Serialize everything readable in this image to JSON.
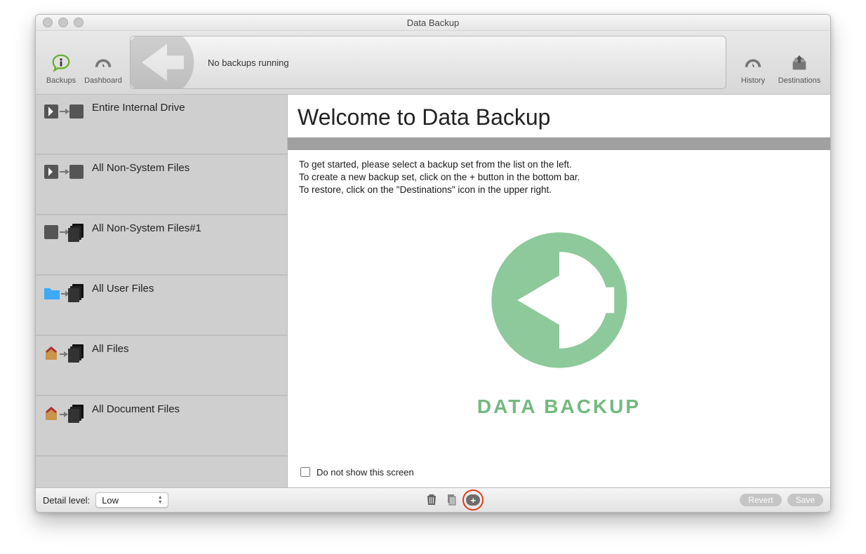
{
  "window": {
    "title": "Data Backup"
  },
  "toolbar": {
    "backups_label": "Backups",
    "dashboard_label": "Dashboard",
    "history_label": "History",
    "destinations_label": "Destinations",
    "status_text": "No backups running"
  },
  "sidebar": {
    "items": [
      {
        "label": "Entire Internal Drive",
        "icon": "drive-to-drive"
      },
      {
        "label": "All Non-System Files",
        "icon": "drive-to-drive"
      },
      {
        "label": "All Non-System Files#1",
        "icon": "drive-to-stack"
      },
      {
        "label": "All User Files",
        "icon": "folder-to-stack"
      },
      {
        "label": "All Files",
        "icon": "home-to-stack"
      },
      {
        "label": "All Document Files",
        "icon": "home-to-stack"
      }
    ]
  },
  "content": {
    "heading": "Welcome to Data Backup",
    "intro_line1": "To get started, please select a backup set from the list on the left.",
    "intro_line2": "To create a new backup set, click on the + button in the bottom bar.",
    "intro_line3": "To restore, click on the \"Destinations\" icon in the upper right.",
    "brand": "DATA BACKUP",
    "dont_show_label": "Do not show this screen",
    "dont_show_checked": false
  },
  "bottombar": {
    "detail_label": "Detail level:",
    "detail_value": "Low",
    "revert_label": "Revert",
    "save_label": "Save"
  },
  "colors": {
    "accent_green": "#6fb97a",
    "highlight_red": "#e23b1a"
  }
}
